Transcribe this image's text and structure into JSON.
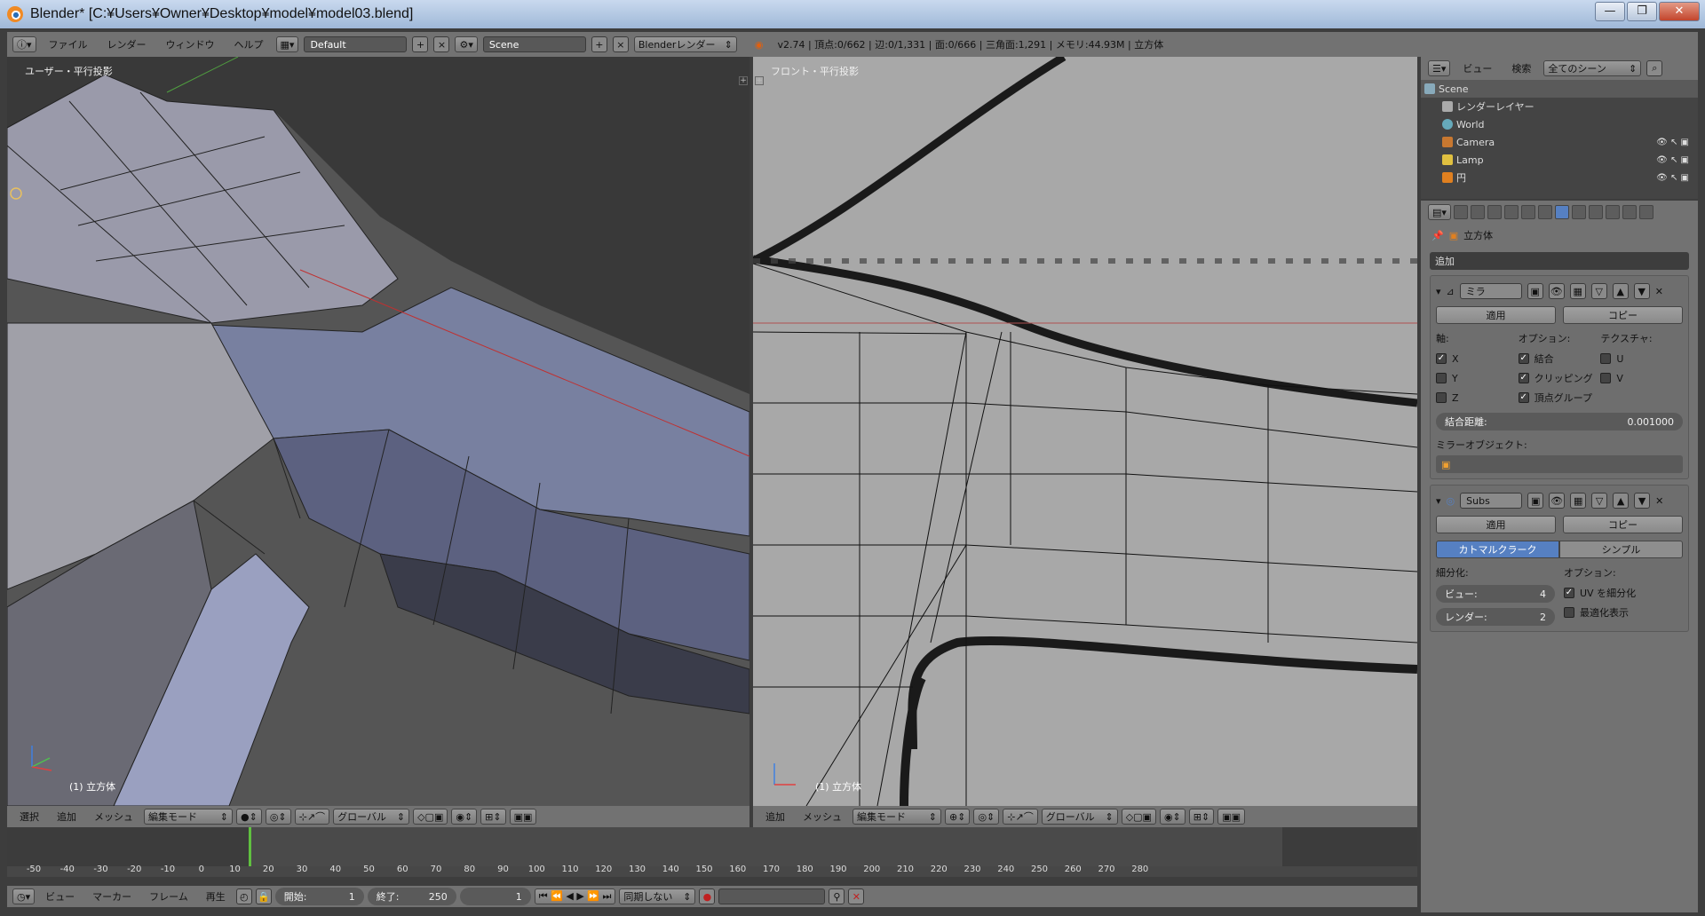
{
  "window": {
    "title": "Blender* [C:¥Users¥Owner¥Desktop¥model¥model03.blend]",
    "controls": [
      "—",
      "❐",
      "✕"
    ]
  },
  "info_header": {
    "menus": [
      "ファイル",
      "レンダー",
      "ウィンドウ",
      "ヘルプ"
    ],
    "layout": "Default",
    "scene": "Scene",
    "engine": "Blenderレンダー",
    "stats": "v2.74 | 頂点:0/662 | 辺:0/1,331 | 面:0/666 | 三角面:1,291 | メモリ:44.93M | 立方体"
  },
  "viewport_left": {
    "label": "ユーザー・平行投影",
    "object": "(1) 立方体",
    "axis_labels": [
      "z",
      "y",
      "x"
    ]
  },
  "viewport_right": {
    "label": "フロント・平行投影",
    "object": "(1) 立方体",
    "axis_labels": [
      "z",
      "x"
    ]
  },
  "viewport_header_left": {
    "menus": [
      "選択",
      "追加",
      "メッシュ"
    ],
    "mode": "編集モード",
    "orientation": "グローバル"
  },
  "viewport_header_right": {
    "menus": [
      "追加",
      "メッシュ"
    ],
    "mode": "編集モード",
    "orientation": "グローバル"
  },
  "timeline": {
    "ticks": [
      "-50",
      "-40",
      "-30",
      "-20",
      "-10",
      "0",
      "10",
      "20",
      "30",
      "40",
      "50",
      "60",
      "70",
      "80",
      "90",
      "100",
      "110",
      "120",
      "130",
      "140",
      "150",
      "160",
      "170",
      "180",
      "190",
      "200",
      "210",
      "220",
      "230",
      "240",
      "250",
      "260",
      "270",
      "280"
    ],
    "current_frame": 1,
    "menus": [
      "ビュー",
      "マーカー",
      "フレーム",
      "再生"
    ],
    "start_label": "開始:",
    "start": "1",
    "end_label": "終了:",
    "end": "250",
    "frame": "1",
    "sync": "同期しない"
  },
  "outliner": {
    "menus": [
      "ビュー",
      "検索"
    ],
    "filter": "全てのシーン",
    "items": [
      {
        "label": "Scene"
      },
      {
        "label": "レンダーレイヤー"
      },
      {
        "label": "World"
      },
      {
        "label": "Camera"
      },
      {
        "label": "Lamp"
      },
      {
        "label": "円"
      }
    ]
  },
  "properties": {
    "object": "立方体",
    "add_modifier": "追加",
    "mirror": {
      "name": "ミラ",
      "apply": "適用",
      "copy": "コピー",
      "axis_label": "軸:",
      "options_label": "オプション:",
      "texture_label": "テクスチャ:",
      "axes": [
        {
          "label": "X",
          "checked": true
        },
        {
          "label": "Y",
          "checked": false
        },
        {
          "label": "Z",
          "checked": false
        }
      ],
      "options": [
        {
          "label": "結合",
          "checked": true
        },
        {
          "label": "クリッピング",
          "checked": true
        },
        {
          "label": "頂点グループ",
          "checked": true
        }
      ],
      "textures": [
        {
          "label": "U",
          "checked": false
        },
        {
          "label": "V",
          "checked": false
        }
      ],
      "merge_label": "結合距離:",
      "merge_value": "0.001000",
      "mirror_object_label": "ミラーオブジェクト:"
    },
    "subsurf": {
      "name": "Subs",
      "apply": "適用",
      "copy": "コピー",
      "type_on": "カトマルクラーク",
      "type_off": "シンプル",
      "subdiv_label": "細分化:",
      "options_label": "オプション:",
      "view_label": "ビュー:",
      "view_value": "4",
      "render_label": "レンダー:",
      "render_value": "2",
      "uv_label": "UV を細分化",
      "uv_checked": true,
      "optimal_label": "最適化表示",
      "optimal_checked": false
    }
  }
}
